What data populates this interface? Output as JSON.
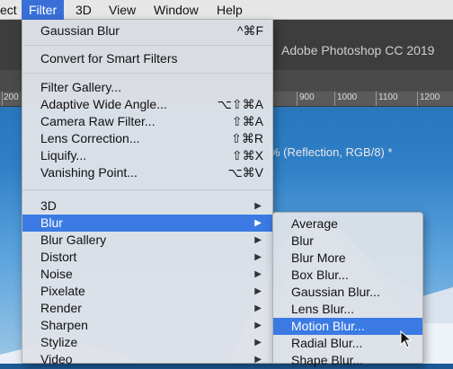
{
  "menubar": {
    "items": [
      {
        "label": "ect"
      },
      {
        "label": "Filter"
      },
      {
        "label": "3D"
      },
      {
        "label": "View"
      },
      {
        "label": "Window"
      },
      {
        "label": "Help"
      }
    ]
  },
  "app": {
    "title": "Adobe Photoshop CC 2019",
    "doc_tab": "% (Reflection, RGB/8) *"
  },
  "ruler": {
    "labels": [
      "200",
      "900",
      "1000",
      "1100",
      "1200"
    ]
  },
  "filter_menu": {
    "last_filter": {
      "label": "Gaussian Blur",
      "shortcut": "^⌘F"
    },
    "convert": {
      "label": "Convert for Smart Filters"
    },
    "filters": [
      {
        "label": "Filter Gallery...",
        "shortcut": ""
      },
      {
        "label": "Adaptive Wide Angle...",
        "shortcut": "⌥⇧⌘A"
      },
      {
        "label": "Camera Raw Filter...",
        "shortcut": "⇧⌘A"
      },
      {
        "label": "Lens Correction...",
        "shortcut": "⇧⌘R"
      },
      {
        "label": "Liquify...",
        "shortcut": "⇧⌘X"
      },
      {
        "label": "Vanishing Point...",
        "shortcut": "⌥⌘V"
      }
    ],
    "submenus": [
      {
        "label": "3D"
      },
      {
        "label": "Blur"
      },
      {
        "label": "Blur Gallery"
      },
      {
        "label": "Distort"
      },
      {
        "label": "Noise"
      },
      {
        "label": "Pixelate"
      },
      {
        "label": "Render"
      },
      {
        "label": "Sharpen"
      },
      {
        "label": "Stylize"
      },
      {
        "label": "Video"
      }
    ],
    "arrow": "▶"
  },
  "blur_submenu": {
    "items": [
      {
        "label": "Average"
      },
      {
        "label": "Blur"
      },
      {
        "label": "Blur More"
      },
      {
        "label": "Box Blur..."
      },
      {
        "label": "Gaussian Blur..."
      },
      {
        "label": "Lens Blur..."
      },
      {
        "label": "Motion Blur..."
      },
      {
        "label": "Radial Blur..."
      },
      {
        "label": "Shape Blur..."
      }
    ]
  },
  "colors": {
    "highlight": "#3b7ae3",
    "menubar_active": "#3a6fd8",
    "menu_bg": "#dee2e8"
  }
}
